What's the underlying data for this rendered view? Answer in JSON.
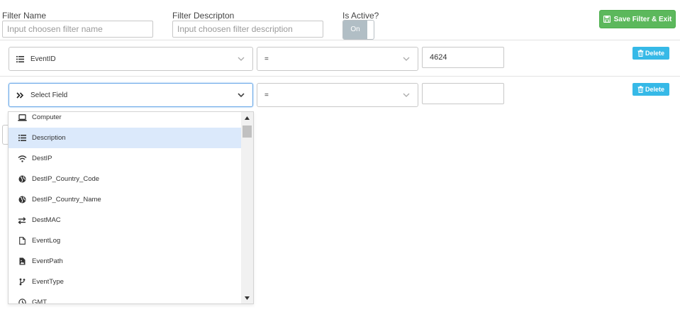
{
  "filter_name": {
    "label": "Filter Name",
    "placeholder": "Input choosen filter name"
  },
  "filter_description": {
    "label": "Filter Descripton",
    "placeholder": "Input choosen filter description"
  },
  "is_active": {
    "label": "Is Active?",
    "toggle_label": "On"
  },
  "save_button": {
    "label": "Save Filter & Exit",
    "icon": "floppy-disk-icon",
    "color": "#5cb85c"
  },
  "rows": [
    {
      "field": "EventID",
      "field_icon": "list-icon",
      "operator": "=",
      "value": "4624",
      "delete_label": "Delete"
    },
    {
      "field": "Select Field",
      "field_icon": "double-chevron-right-icon",
      "operator": "=",
      "value": "",
      "delete_label": "Delete"
    }
  ],
  "dropdown": {
    "items": [
      {
        "label": "Computer",
        "icon": "laptop-icon"
      },
      {
        "label": "Description",
        "icon": "list-icon",
        "active": true
      },
      {
        "label": "DestIP",
        "icon": "wifi-icon"
      },
      {
        "label": "DestIP_Country_Code",
        "icon": "globe-icon"
      },
      {
        "label": "DestIP_Country_Name",
        "icon": "globe-icon"
      },
      {
        "label": "DestMAC",
        "icon": "exchange-arrows-icon"
      },
      {
        "label": "EventLog",
        "icon": "file-icon"
      },
      {
        "label": "EventPath",
        "icon": "file-image-icon"
      },
      {
        "label": "EventType",
        "icon": "code-branch-icon"
      },
      {
        "label": "GMT",
        "icon": "clock-icon"
      }
    ]
  },
  "colors": {
    "accent": "#36b9e7",
    "focus_border": "#6aa8e8",
    "active_item_bg": "#dbe9fb",
    "toggle_bg": "#b1bec5"
  }
}
